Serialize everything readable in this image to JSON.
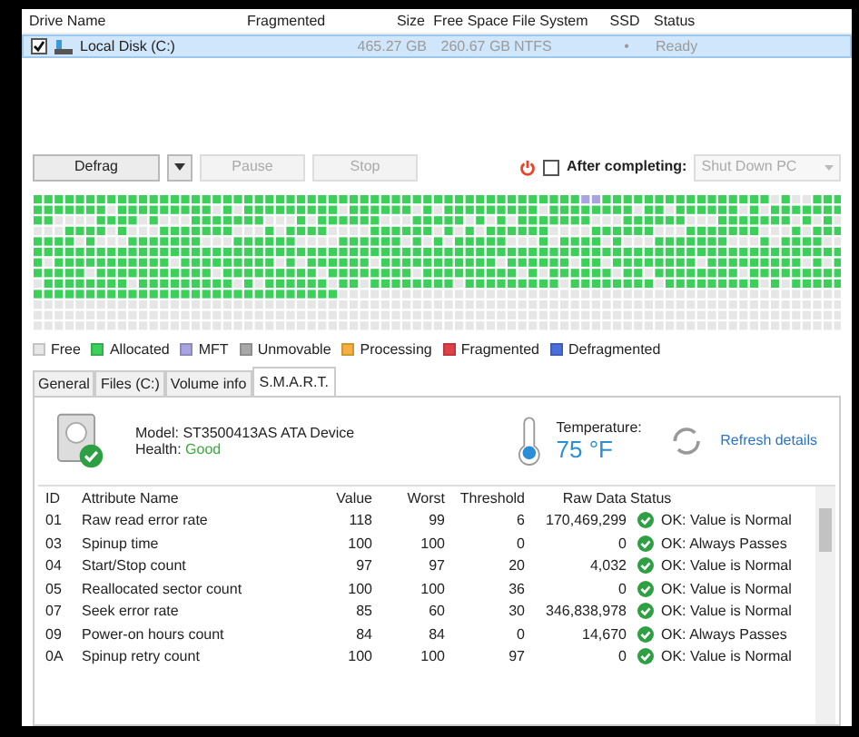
{
  "drives": {
    "columns": [
      "Drive Name",
      "Fragmented",
      "Size",
      "Free Space",
      "File System",
      "SSD",
      "Status"
    ],
    "rows": [
      {
        "checked": true,
        "selected": true,
        "name": "Local Disk (C:)",
        "size": "465.27 GB",
        "free": "260.67 GB",
        "fs": "NTFS",
        "ssd": "•",
        "status": "Ready"
      }
    ]
  },
  "toolbar": {
    "buttons": [
      {
        "label": "Defrag",
        "disabled": false,
        "dropdown": true
      },
      {
        "label": "Pause",
        "disabled": true,
        "dropdown": false
      },
      {
        "label": "Stop",
        "disabled": true,
        "dropdown": false
      }
    ],
    "after_completing": {
      "checked": false,
      "label": "After completing:",
      "value": "Shut Down PC",
      "disabled": true
    }
  },
  "legend": [
    {
      "label": "Free",
      "color": "#e6e6e6"
    },
    {
      "label": "Allocated",
      "color": "#3ccf5a"
    },
    {
      "label": "MFT",
      "color": "#a9a3e0"
    },
    {
      "label": "Unmovable",
      "color": "#a8a8a8"
    },
    {
      "label": "Processing",
      "color": "#f5b041"
    },
    {
      "label": "Fragmented",
      "color": "#e0404a"
    },
    {
      "label": "Defragmented",
      "color": "#4a6fd8"
    }
  ],
  "tabs": [
    {
      "label": "General",
      "selected": false
    },
    {
      "label": "Files (C:)",
      "selected": false
    },
    {
      "label": "Volume info",
      "selected": false
    },
    {
      "label": "S.M.A.R.T.",
      "selected": true
    }
  ],
  "smart": {
    "model": "Model: ST3500413AS ATA Device",
    "health_label": "Health:",
    "health": "Good",
    "temperature_label": "Temperature:",
    "temperature": "75 °F",
    "refresh": "Refresh details",
    "columns": [
      "ID",
      "Attribute Name",
      "Value",
      "Worst",
      "Threshold",
      "Raw Data",
      "Status"
    ],
    "rows": [
      {
        "id": "01",
        "name": "Raw read error rate",
        "value": "118",
        "worst": "99",
        "threshold": "6",
        "raw": "170,469,299",
        "status": "OK: Value is Normal"
      },
      {
        "id": "03",
        "name": "Spinup time",
        "value": "100",
        "worst": "100",
        "threshold": "0",
        "raw": "0",
        "status": "OK: Always Passes"
      },
      {
        "id": "04",
        "name": "Start/Stop count",
        "value": "97",
        "worst": "97",
        "threshold": "20",
        "raw": "4,032",
        "status": "OK: Value is Normal"
      },
      {
        "id": "05",
        "name": "Reallocated sector count",
        "value": "100",
        "worst": "100",
        "threshold": "36",
        "raw": "0",
        "status": "OK: Value is Normal"
      },
      {
        "id": "07",
        "name": "Seek error rate",
        "value": "85",
        "worst": "60",
        "threshold": "30",
        "raw": "346,838,978",
        "status": "OK: Value is Normal"
      },
      {
        "id": "09",
        "name": "Power-on hours count",
        "value": "84",
        "worst": "84",
        "threshold": "0",
        "raw": "14,670",
        "status": "OK: Always Passes"
      },
      {
        "id": "0A",
        "name": "Spinup retry count",
        "value": "100",
        "worst": "100",
        "threshold": "97",
        "raw": "0",
        "status": "OK: Value is Normal"
      }
    ]
  }
}
